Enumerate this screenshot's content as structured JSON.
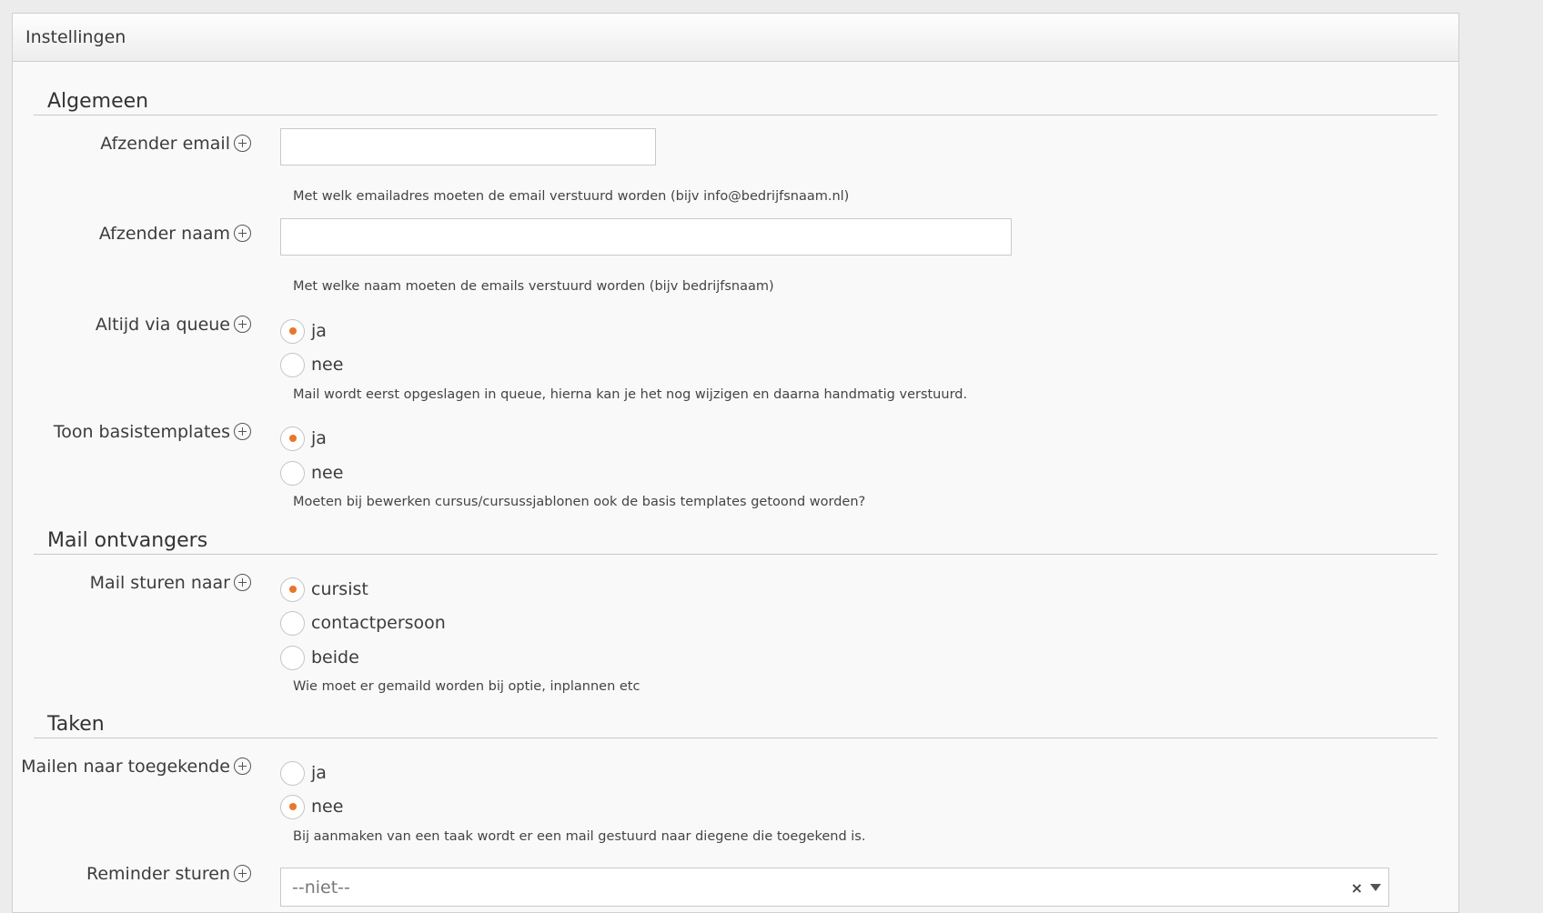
{
  "panel": {
    "title": "Instellingen"
  },
  "sections": {
    "algemeen": "Algemeen",
    "mail_ontvangers": "Mail ontvangers",
    "taken": "Taken"
  },
  "fields": {
    "afzender_email": {
      "label": "Afzender email",
      "value": "",
      "help": "Met welk emailadres moeten de email verstuurd worden (bijv info@bedrijfsnaam.nl)"
    },
    "afzender_naam": {
      "label": "Afzender naam",
      "value": "",
      "help": "Met welke naam moeten de emails verstuurd worden (bijv bedrijfsnaam)"
    },
    "altijd_via_queue": {
      "label": "Altijd via queue",
      "options": [
        "ja",
        "nee"
      ],
      "selected": "ja",
      "help": "Mail wordt eerst opgeslagen in queue, hierna kan je het nog wijzigen en daarna handmatig verstuurd."
    },
    "toon_basistemplates": {
      "label": "Toon basistemplates",
      "options": [
        "ja",
        "nee"
      ],
      "selected": "ja",
      "help": "Moeten bij bewerken cursus/cursussjablonen ook de basis templates getoond worden?"
    },
    "mail_sturen_naar": {
      "label": "Mail sturen naar",
      "options": [
        "cursist",
        "contactpersoon",
        "beide"
      ],
      "selected": "cursist",
      "help": "Wie moet er gemaild worden bij optie, inplannen etc"
    },
    "mailen_naar_toegekende": {
      "label": "Mailen naar toegekende",
      "options": [
        "ja",
        "nee"
      ],
      "selected": "nee",
      "help": "Bij aanmaken van een taak wordt er een mail gestuurd naar diegene die toegekend is."
    },
    "reminder_sturen": {
      "label": "Reminder sturen",
      "value": "--niet--",
      "clear_icon": "×"
    }
  },
  "colors": {
    "accent": "#e8762b",
    "panel_bg": "#f9f9f9",
    "page_bg": "#ececec"
  },
  "icons": {
    "field_info": "plus-circle-icon",
    "select_toggle": "chevron-down-icon"
  }
}
